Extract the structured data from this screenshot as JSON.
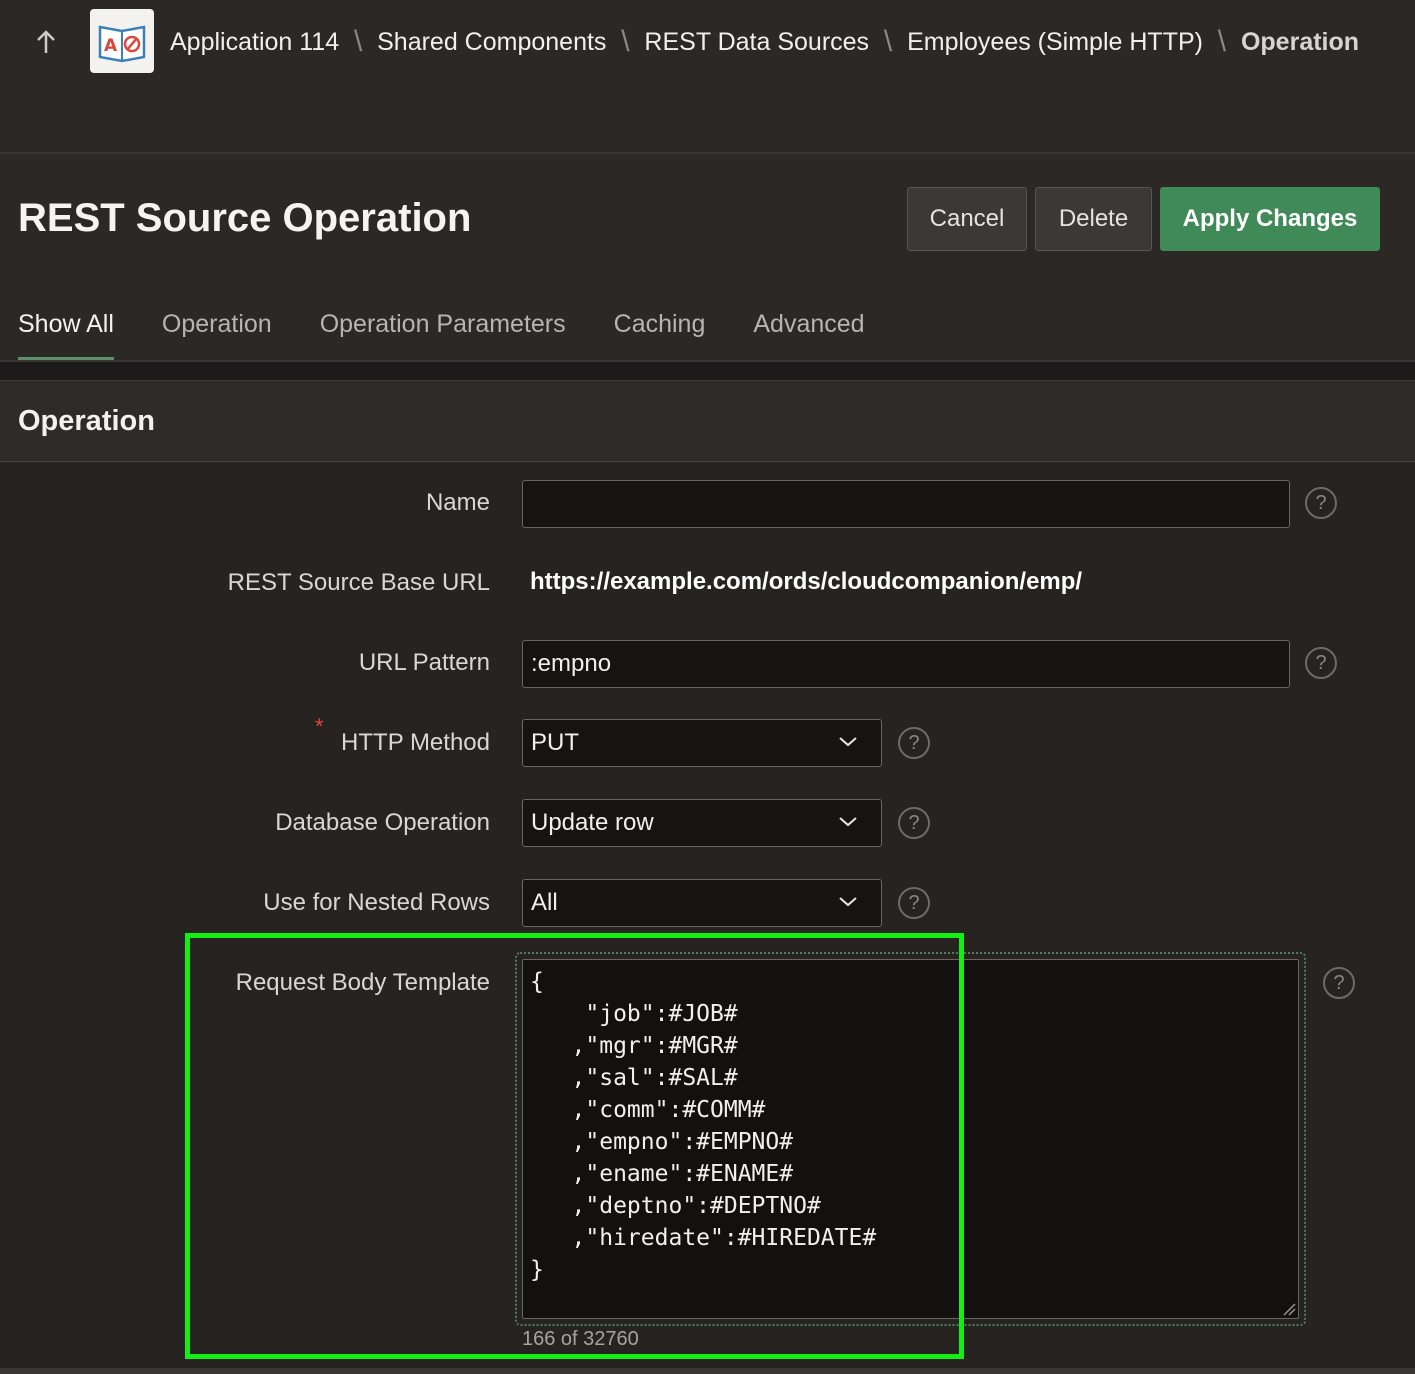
{
  "breadcrumb": {
    "items": [
      "Application 114",
      "Shared Components",
      "REST Data Sources",
      "Employees (Simple HTTP)"
    ],
    "current": "Operation"
  },
  "app_icon": "app-builder-book-icon",
  "page": {
    "title": "REST Source Operation",
    "cancel_label": "Cancel",
    "delete_label": "Delete",
    "apply_label": "Apply Changes"
  },
  "tabs": [
    "Show All",
    "Operation",
    "Operation Parameters",
    "Caching",
    "Advanced"
  ],
  "region": {
    "title": "Operation"
  },
  "form": {
    "name_label": "Name",
    "name_value": "",
    "base_url_label": "REST Source Base URL",
    "base_url_value": "https://example.com/ords/cloudcompanion/emp/",
    "url_pattern_label": "URL Pattern",
    "url_pattern_value": ":empno",
    "required_marker": "*",
    "http_method_label": "HTTP Method",
    "http_method_value": "PUT",
    "db_operation_label": "Database Operation",
    "db_operation_value": "Update row",
    "nested_rows_label": "Use for Nested Rows",
    "nested_rows_value": "All",
    "request_body_label": "Request Body Template",
    "request_body_value": "{\n    \"job\":#JOB#\n   ,\"mgr\":#MGR#\n   ,\"sal\":#SAL#\n   ,\"comm\":#COMM#\n   ,\"empno\":#EMPNO#\n   ,\"ename\":#ENAME#\n   ,\"deptno\":#DEPTNO#\n   ,\"hiredate\":#HIREDATE#\n}",
    "char_counter": "166 of 32760"
  },
  "colors": {
    "accent": "#3f8a57",
    "highlight": "#14ee14",
    "background": "#2b2825"
  }
}
